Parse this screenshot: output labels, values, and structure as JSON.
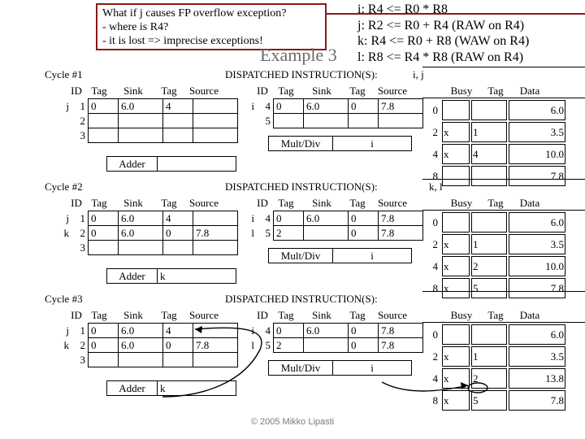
{
  "callout": {
    "line1": "What if j causes FP overflow exception?",
    "line2": "- where is R4?",
    "line3": "- it is lost => imprecise exceptions!"
  },
  "title": "Example 3",
  "instructions": [
    "i: R4 <= R0 * R8",
    "j: R2 <= R0 + R4 (RAW on R4)",
    "k: R4 <= R0 + R8 (WAW on R4)",
    "l: R8 <= R4 * R8 (RAW on R4)"
  ],
  "footer": "© 2005 Mikko Lipasti",
  "rs_headers": [
    "ID",
    "Tag",
    "Sink",
    "Tag",
    "Source"
  ],
  "busy_headers": [
    "Busy",
    "Tag",
    "Data"
  ],
  "dispatch_label": "DISPATCHED INSTRUCTION(S):",
  "cycles": [
    {
      "name": "Cycle #1",
      "dispatched": "i, j",
      "adder_label": "Adder",
      "adder_tag": "",
      "muldiv_label": "Mult/Div",
      "muldiv_tag": "i",
      "left_rows": [
        {
          "mark": "j",
          "id": "1",
          "tag": "0",
          "sink": "6.0",
          "tag2": "4",
          "source": ""
        },
        {
          "mark": "",
          "id": "2",
          "tag": "",
          "sink": "",
          "tag2": "",
          "source": ""
        },
        {
          "mark": "",
          "id": "3",
          "tag": "",
          "sink": "",
          "tag2": "",
          "source": ""
        }
      ],
      "right_rows": [
        {
          "mark": "i",
          "id": "4",
          "tag": "0",
          "sink": "6.0",
          "tag2": "0",
          "source": "7.8"
        },
        {
          "mark": "",
          "id": "5",
          "tag": "",
          "sink": "",
          "tag2": "",
          "source": ""
        }
      ],
      "busy_rows": [
        {
          "reg": "0",
          "busy": "",
          "tag": "",
          "data": "6.0"
        },
        {
          "reg": "2",
          "busy": "x",
          "tag": "1",
          "data": "3.5"
        },
        {
          "reg": "4",
          "busy": "x",
          "tag": "4",
          "data": "10.0"
        },
        {
          "reg": "8",
          "busy": "",
          "tag": "",
          "data": "7.8"
        }
      ]
    },
    {
      "name": "Cycle #2",
      "dispatched": "k, l",
      "adder_label": "Adder",
      "adder_tag": "k",
      "muldiv_label": "Mult/Div",
      "muldiv_tag": "i",
      "left_rows": [
        {
          "mark": "j",
          "id": "1",
          "tag": "0",
          "sink": "6.0",
          "tag2": "4",
          "source": ""
        },
        {
          "mark": "k",
          "id": "2",
          "tag": "0",
          "sink": "6.0",
          "tag2": "0",
          "source": "7.8"
        },
        {
          "mark": "",
          "id": "3",
          "tag": "",
          "sink": "",
          "tag2": "",
          "source": ""
        }
      ],
      "right_rows": [
        {
          "mark": "i",
          "id": "4",
          "tag": "0",
          "sink": "6.0",
          "tag2": "0",
          "source": "7.8"
        },
        {
          "mark": "l",
          "id": "5",
          "tag": "2",
          "sink": "",
          "tag2": "0",
          "source": "7.8"
        }
      ],
      "busy_rows": [
        {
          "reg": "0",
          "busy": "",
          "tag": "",
          "data": "6.0"
        },
        {
          "reg": "2",
          "busy": "x",
          "tag": "1",
          "data": "3.5"
        },
        {
          "reg": "4",
          "busy": "x",
          "tag": "2",
          "data": "10.0"
        },
        {
          "reg": "8",
          "busy": "x",
          "tag": "5",
          "data": "7.8"
        }
      ]
    },
    {
      "name": "Cycle #3",
      "dispatched": "",
      "adder_label": "Adder",
      "adder_tag": "k",
      "muldiv_label": "Mult/Div",
      "muldiv_tag": "i",
      "left_rows": [
        {
          "mark": "j",
          "id": "1",
          "tag": "0",
          "sink": "6.0",
          "tag2": "4",
          "source": ""
        },
        {
          "mark": "k",
          "id": "2",
          "tag": "0",
          "sink": "6.0",
          "tag2": "0",
          "source": "7.8"
        },
        {
          "mark": "",
          "id": "3",
          "tag": "",
          "sink": "",
          "tag2": "",
          "source": ""
        }
      ],
      "right_rows": [
        {
          "mark": "i",
          "id": "4",
          "tag": "0",
          "sink": "6.0",
          "tag2": "0",
          "source": "7.8"
        },
        {
          "mark": "l",
          "id": "5",
          "tag": "2",
          "sink": "",
          "tag2": "0",
          "source": "7.8"
        }
      ],
      "busy_rows": [
        {
          "reg": "0",
          "busy": "",
          "tag": "",
          "data": "6.0"
        },
        {
          "reg": "2",
          "busy": "x",
          "tag": "1",
          "data": "3.5"
        },
        {
          "reg": "4",
          "busy": "x",
          "tag": "2",
          "data": "13.8"
        },
        {
          "reg": "8",
          "busy": "x",
          "tag": "5",
          "data": "7.8"
        }
      ]
    }
  ]
}
